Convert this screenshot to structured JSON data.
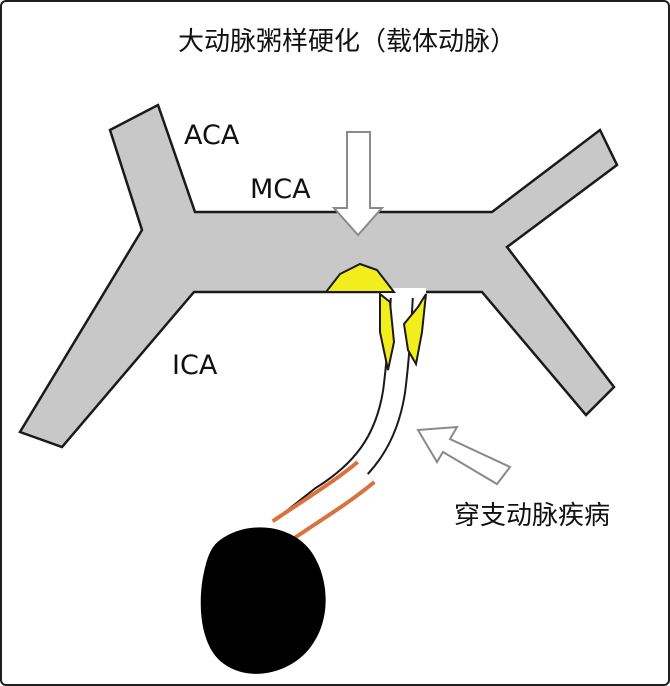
{
  "title": "大动脉粥样硬化（载体动脉）",
  "labels": {
    "aca": "ACA",
    "mca": "MCA",
    "ica": "ICA",
    "penetrating": "穿支动脉疾病"
  },
  "colors": {
    "artery": "#c8c8c8",
    "outline": "#1a1a1a",
    "plaque": "#f2ee1e",
    "vessel_wall": "#d9723e",
    "infarct": "#000000",
    "arrow_fill": "#ffffff",
    "arrow_stroke": "#8a8a8a"
  }
}
